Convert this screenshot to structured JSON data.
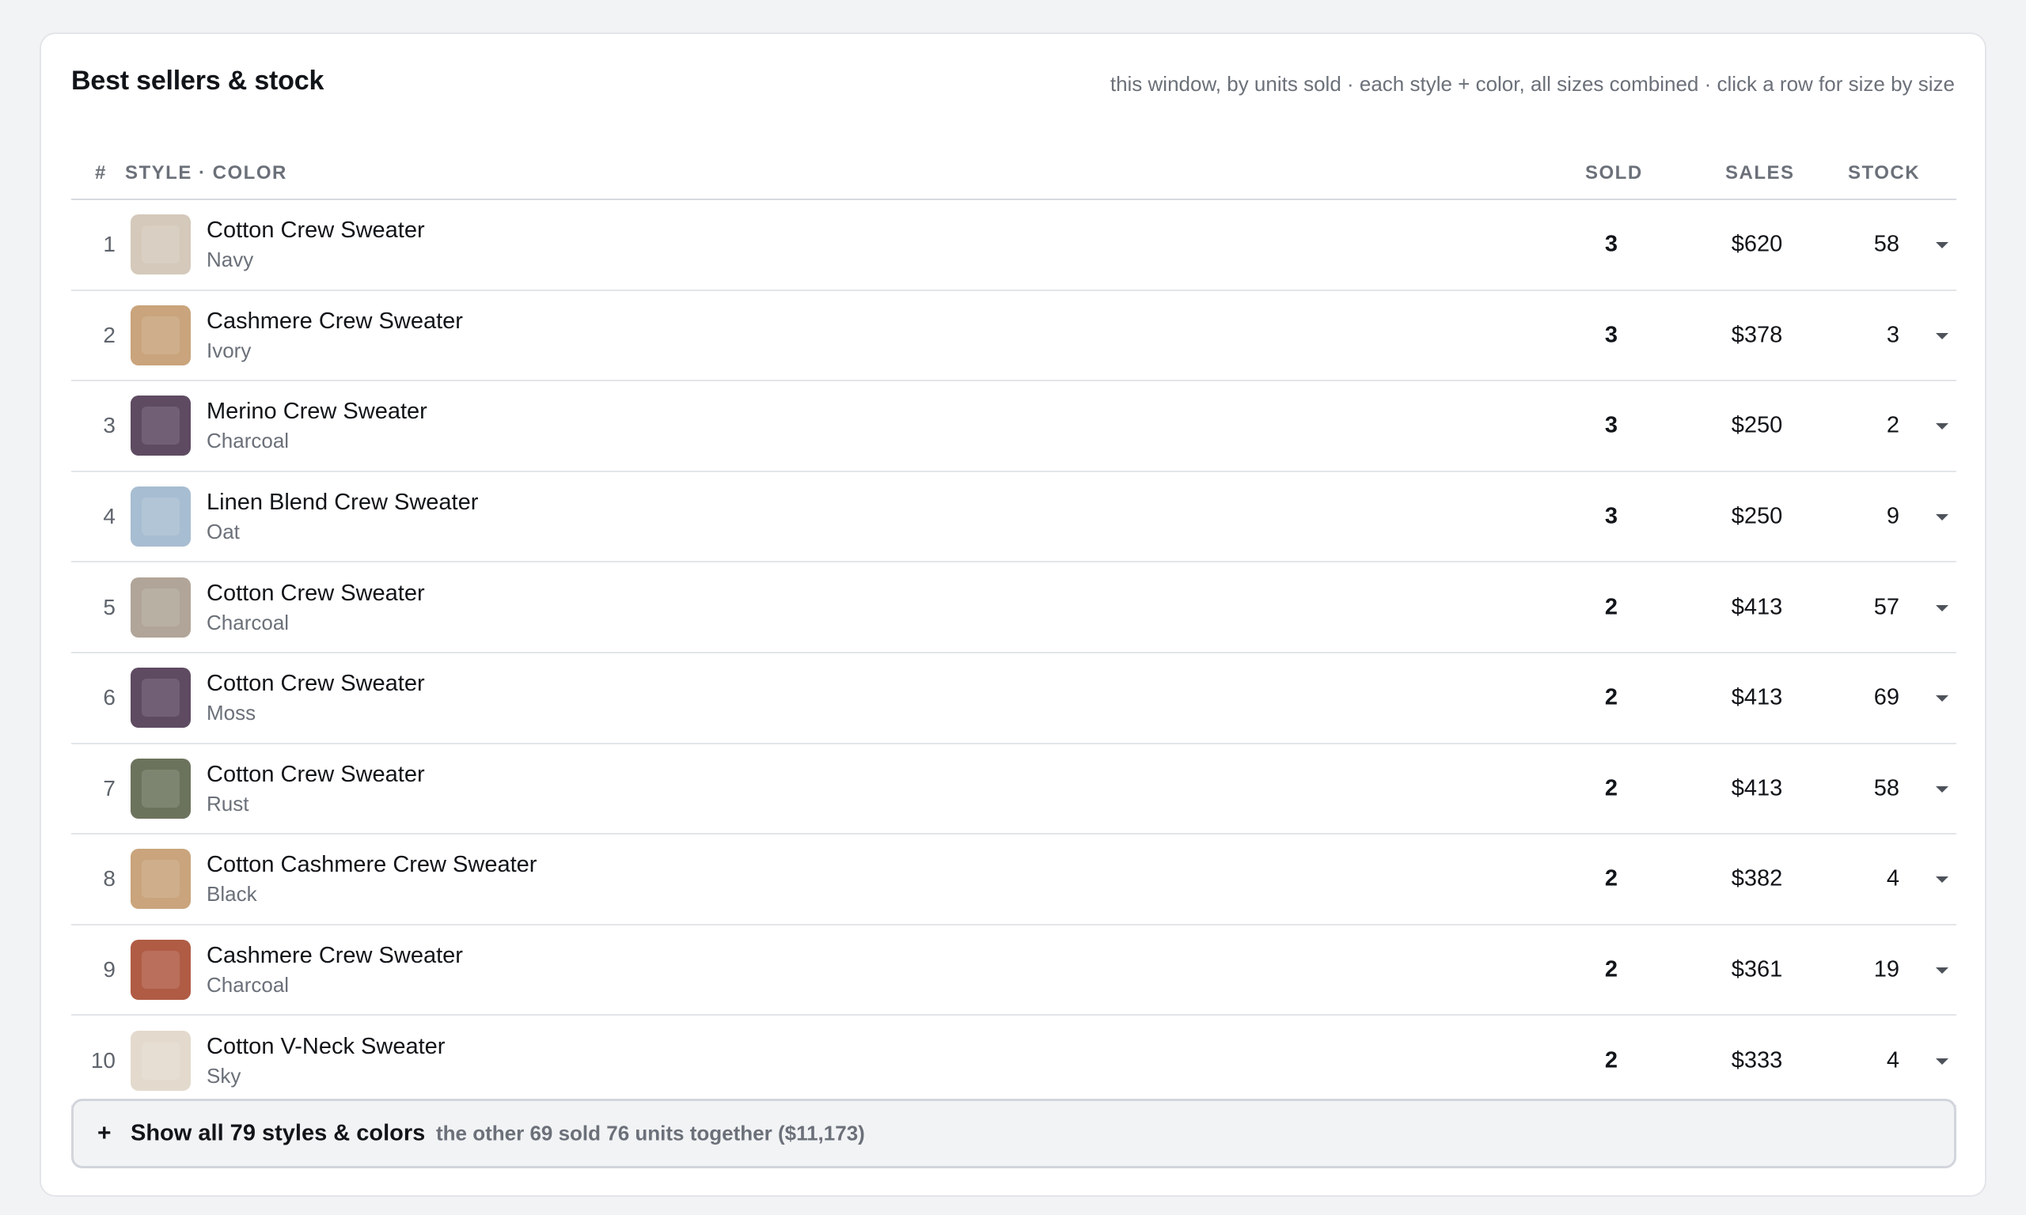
{
  "card": {
    "title": "Best sellers & stock",
    "subtitle": "this window, by units sold · each style + color, all sizes combined · click a row for size by size"
  },
  "table": {
    "headers": {
      "rank": "#",
      "style_color": "STYLE · COLOR",
      "sold": "SOLD",
      "sales": "SALES",
      "stock": "STOCK"
    },
    "rows": [
      {
        "rank": "1",
        "style": "Cotton Crew Sweater",
        "color": "Navy",
        "swatch": "#d4c9ba",
        "sold": "3",
        "sales": "$620",
        "stock": "58"
      },
      {
        "rank": "2",
        "style": "Cashmere Crew Sweater",
        "color": "Ivory",
        "swatch": "#c9a47c",
        "sold": "3",
        "sales": "$378",
        "stock": "3"
      },
      {
        "rank": "3",
        "style": "Merino Crew Sweater",
        "color": "Charcoal",
        "swatch": "#5e4b62",
        "sold": "3",
        "sales": "$250",
        "stock": "2"
      },
      {
        "rank": "4",
        "style": "Linen Blend Crew Sweater",
        "color": "Oat",
        "swatch": "#a7bdd1",
        "sold": "3",
        "sales": "$250",
        "stock": "9"
      },
      {
        "rank": "5",
        "style": "Cotton Crew Sweater",
        "color": "Charcoal",
        "swatch": "#b0a598",
        "sold": "2",
        "sales": "$413",
        "stock": "57"
      },
      {
        "rank": "6",
        "style": "Cotton Crew Sweater",
        "color": "Moss",
        "swatch": "#5e4b62",
        "sold": "2",
        "sales": "$413",
        "stock": "69"
      },
      {
        "rank": "7",
        "style": "Cotton Crew Sweater",
        "color": "Rust",
        "swatch": "#6c735d",
        "sold": "2",
        "sales": "$413",
        "stock": "58"
      },
      {
        "rank": "8",
        "style": "Cotton Cashmere Crew Sweater",
        "color": "Black",
        "swatch": "#c9a47c",
        "sold": "2",
        "sales": "$382",
        "stock": "4"
      },
      {
        "rank": "9",
        "style": "Cashmere Crew Sweater",
        "color": "Charcoal",
        "swatch": "#b05c45",
        "sold": "2",
        "sales": "$361",
        "stock": "19"
      },
      {
        "rank": "10",
        "style": "Cotton V-Neck Sweater",
        "color": "Sky",
        "swatch": "#e3dacd",
        "sold": "2",
        "sales": "$333",
        "stock": "4"
      }
    ]
  },
  "show_all": {
    "icon": "plus-icon",
    "label": "Show all 79 styles & colors",
    "note": "the other 69 sold 76 units together ($11,173)"
  },
  "icons": {
    "row_expand": "chevron-down-icon"
  },
  "colors": {
    "background": "#f2f3f5",
    "card": "#ffffff",
    "muted_text": "#6b7079"
  }
}
